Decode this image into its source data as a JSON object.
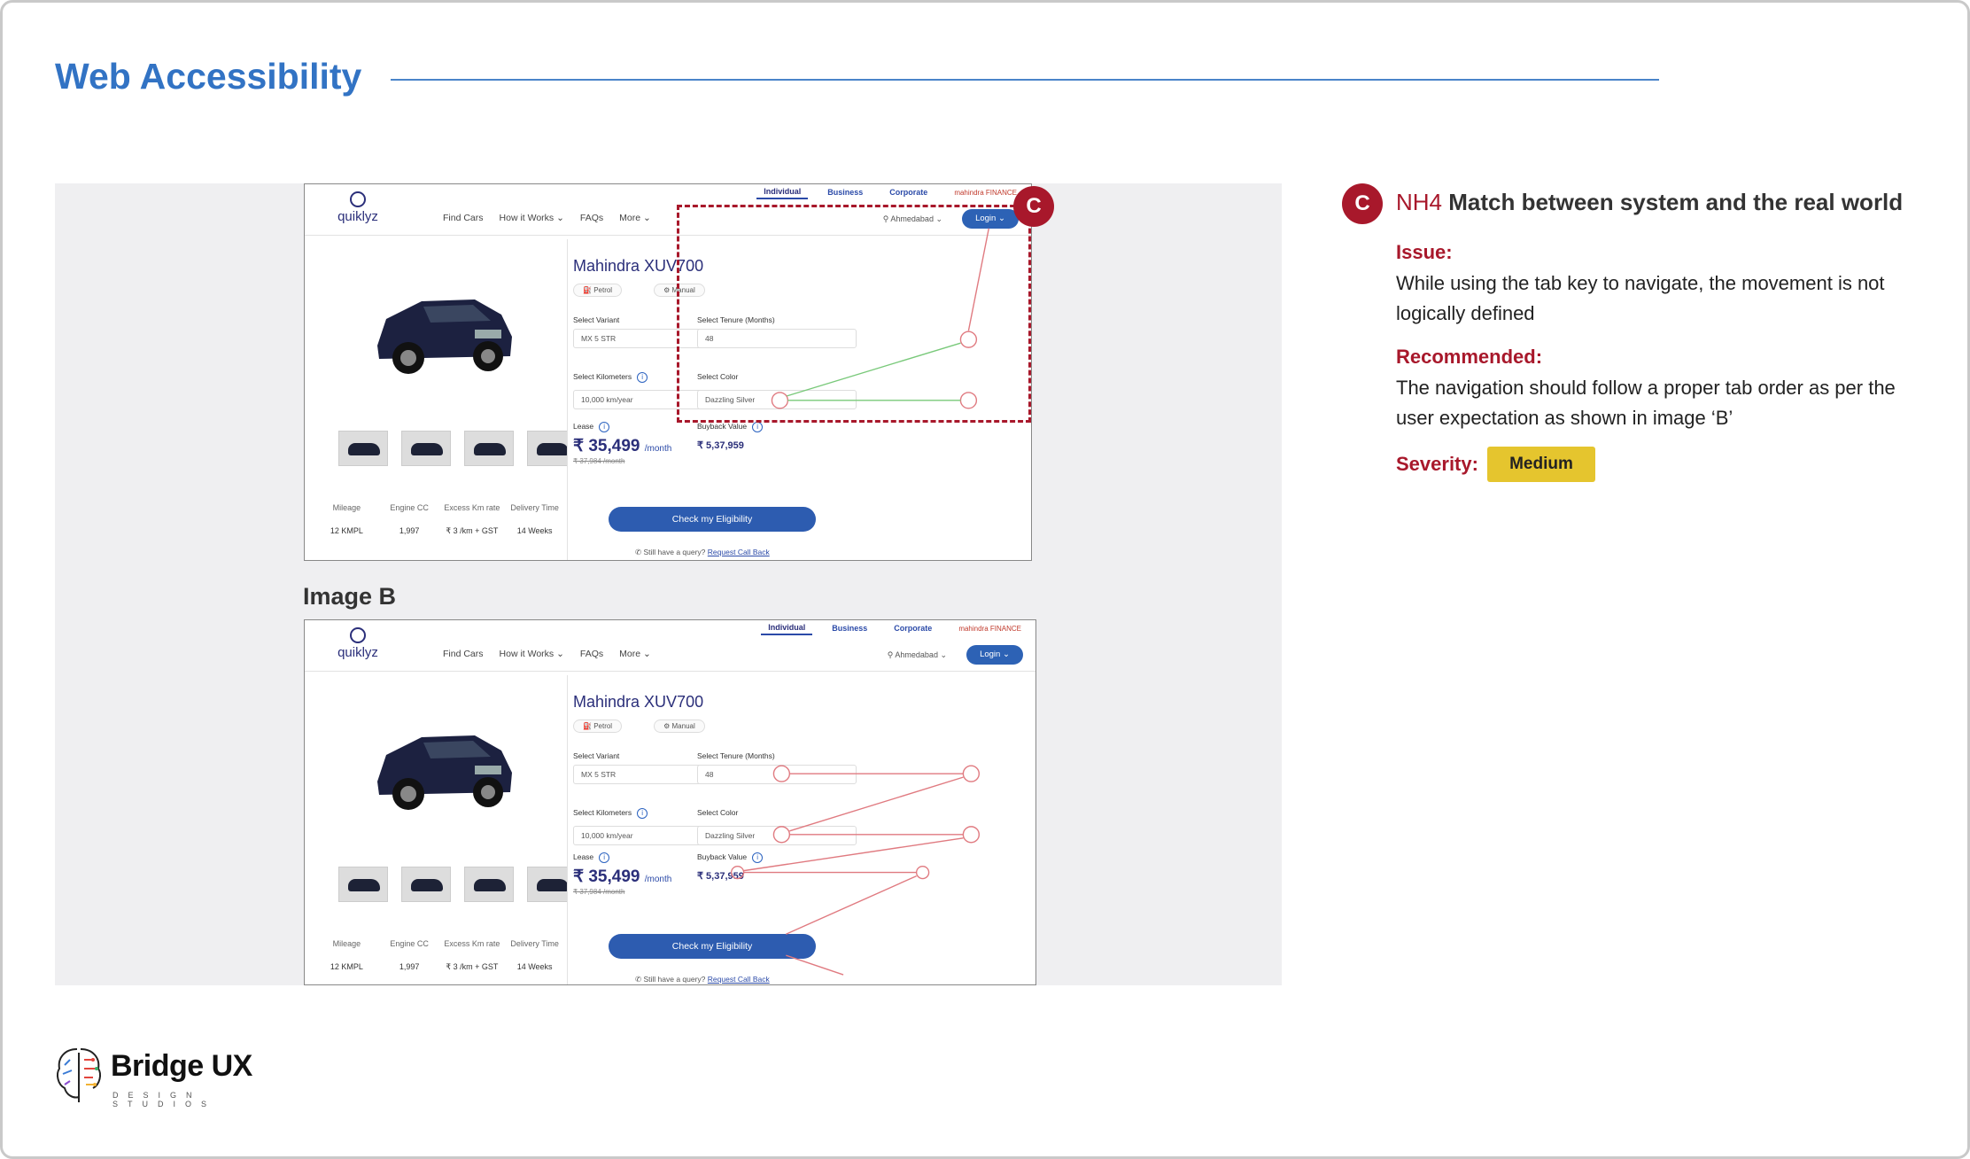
{
  "slide": {
    "title": "Web Accessibility",
    "image_b_label": "Image B"
  },
  "mock": {
    "logo": "quiklyz",
    "nav": [
      "Find Cars",
      "How it Works",
      "FAQs",
      "More"
    ],
    "top_tabs": [
      "Individual",
      "Business",
      "Corporate"
    ],
    "finance_brand": "mahindra FINANCE",
    "city": "Ahmedabad",
    "login": "Login",
    "car_title": "Mahindra XUV700",
    "fuel": "Petrol",
    "transmission": "Manual",
    "variant_label": "Select Variant",
    "variant_value": "MX 5 STR",
    "tenure_label": "Select Tenure (Months)",
    "tenure_value": "48",
    "km_label": "Select Kilometers",
    "km_value": "10,000 km/year",
    "color_label": "Select Color",
    "color_value": "Dazzling Silver",
    "lease_label": "Lease",
    "lease_price": "₹ 35,499",
    "per_month": "/month",
    "lease_strike": "₹ 37,984 /month",
    "buyback_label": "Buyback Value",
    "buyback_value": "₹ 5,37,959",
    "cta": "Check my Eligibility",
    "query": "Still have a query?",
    "callback": "Request Call Back",
    "spec_headers": [
      "Mileage",
      "Engine CC",
      "Excess Km rate",
      "Delivery Time"
    ],
    "spec_values": [
      "12 KMPL",
      "1,997",
      "₹ 3 /km + GST",
      "14 Weeks"
    ]
  },
  "annotation": {
    "badge": "C",
    "code": "NH4",
    "heading": "Match between system and the real world",
    "issue_label": "Issue:",
    "issue_text": "While using the tab key to navigate, the movement is not logically defined",
    "recommended_label": "Recommended:",
    "recommended_text": "The navigation should follow a proper tab order as per the user expectation as shown in image ‘B’",
    "severity_label": "Severity:",
    "severity_value": "Medium",
    "severity_color": "#e5c52e",
    "accent_color": "#a8182b"
  },
  "footer": {
    "brand": "Bridge UX",
    "brand_sub": "DESIGN STUDIOS"
  }
}
